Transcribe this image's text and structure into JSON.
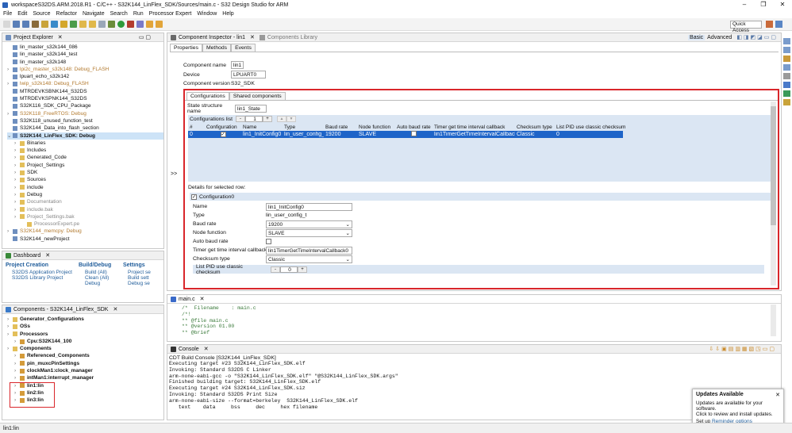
{
  "window": {
    "title": "workspaceS32DS.ARM.2018.R1 - C/C++ - S32K144_LinFlex_SDK/Sources/main.c - S32 Design Studio for ARM",
    "min": "–",
    "max": "❐",
    "close": "✕"
  },
  "menu": [
    "File",
    "Edit",
    "Source",
    "Refactor",
    "Navigate",
    "Search",
    "Run",
    "Processor Expert",
    "Window",
    "Help"
  ],
  "quick_access": "Quick Access",
  "project_explorer": {
    "title": "Project Explorer",
    "items": [
      {
        "label": "lin_master_s32k144_086",
        "cls": ""
      },
      {
        "label": "lin_master_s32k144_test",
        "cls": ""
      },
      {
        "label": "lin_master_s32k148",
        "cls": ""
      },
      {
        "label": "lpi2c_master_s32k148: Debug_FLASH",
        "cls": "orange",
        "tw": "›"
      },
      {
        "label": "lpuart_echo_s32k142",
        "cls": ""
      },
      {
        "label": "lwip_s32k148: Debug_FLASH",
        "cls": "orange",
        "tw": "›"
      },
      {
        "label": "MTRDEVKSBNK144_S32DS",
        "cls": ""
      },
      {
        "label": "MTRDEVKSPNK144_S32DS",
        "cls": ""
      },
      {
        "label": "S32K116_SDK_CPU_Package",
        "cls": ""
      },
      {
        "label": "S32K118_FreeRTOS: Debug",
        "cls": "orange",
        "tw": "›"
      },
      {
        "label": "S32K118_unused_function_test",
        "cls": ""
      },
      {
        "label": "S32K144_Data_into_flash_section",
        "cls": ""
      },
      {
        "label": "S32K144_LinFlex_SDK: Debug",
        "cls": "bold sel",
        "tw": "⌄"
      },
      {
        "label": "Binaries",
        "cls": "",
        "ind": 1,
        "tw": "›"
      },
      {
        "label": "Includes",
        "cls": "",
        "ind": 1,
        "tw": "›"
      },
      {
        "label": "Generated_Code",
        "cls": "",
        "ind": 1,
        "tw": "›"
      },
      {
        "label": "Project_Settings",
        "cls": "",
        "ind": 1,
        "tw": "›"
      },
      {
        "label": "SDK",
        "cls": "",
        "ind": 1,
        "tw": "›"
      },
      {
        "label": "Sources",
        "cls": "",
        "ind": 1,
        "tw": "›"
      },
      {
        "label": "include",
        "cls": "",
        "ind": 1,
        "tw": "›"
      },
      {
        "label": "Debug",
        "cls": "",
        "ind": 1,
        "tw": "›"
      },
      {
        "label": "Documentation",
        "cls": "gray",
        "ind": 1,
        "tw": "›"
      },
      {
        "label": "include.bak",
        "cls": "gray",
        "ind": 1,
        "tw": "›"
      },
      {
        "label": "Project_Settings.bak",
        "cls": "gray",
        "ind": 1,
        "tw": "›"
      },
      {
        "label": "ProcessorExpert.pe",
        "cls": "gray",
        "ind": 2
      },
      {
        "label": "S32K144_memcpy: Debug",
        "cls": "orange",
        "tw": "›"
      },
      {
        "label": "S32K144_newProject",
        "cls": ""
      }
    ]
  },
  "dashboard": {
    "title": "Dashboard",
    "project_creation": {
      "title": "Project Creation",
      "links": [
        "S32DS Application Project",
        "S32DS Library Project"
      ]
    },
    "build_debug": {
      "title": "Build/Debug",
      "links": [
        "Build  (All)",
        "Clean  (All)",
        "Debug"
      ]
    },
    "settings": {
      "title": "Settings",
      "links": [
        "Project se",
        "Build sett",
        "Debug se"
      ]
    }
  },
  "components": {
    "title": "Components - S32K144_LinFlex_SDK",
    "items": [
      {
        "label": "Generator_Configurations",
        "bold": true,
        "ind": 0
      },
      {
        "label": "OSs",
        "bold": true,
        "ind": 0
      },
      {
        "label": "Processors",
        "bold": true,
        "ind": 0
      },
      {
        "label": "Cpu:S32K144_100",
        "bold": true,
        "ind": 1
      },
      {
        "label": "Components",
        "bold": true,
        "ind": 0
      },
      {
        "label": "Referenced_Components",
        "bold": true,
        "ind": 1
      },
      {
        "label": "pin_muxcPinSettings",
        "bold": true,
        "ind": 1
      },
      {
        "label": "clockMan1:clock_manager",
        "bold": true,
        "ind": 1
      },
      {
        "label": "intMan1:interrupt_manager",
        "bold": true,
        "ind": 1
      },
      {
        "label": "lin1:lin",
        "bold": true,
        "ind": 1
      },
      {
        "label": "lin2:lin",
        "bold": true,
        "ind": 1
      },
      {
        "label": "lin3:lin",
        "bold": true,
        "ind": 1
      }
    ]
  },
  "inspector": {
    "title": "Component Inspector - lin1",
    "library_tab": "Components Library",
    "basic": "Basic",
    "advanced": "Advanced",
    "tabs": [
      "Properties",
      "Methods",
      "Events"
    ],
    "component_name_label": "Component name",
    "component_name": "lin1",
    "device_label": "Device",
    "device": "LPUART0",
    "version_label": "Component version",
    "version": "S32_SDK",
    "subtabs": [
      "Configurations",
      "Shared components"
    ],
    "state_label": "State structure name",
    "state_value": "lin1_State",
    "configs_list_label": "Configurations list",
    "configs_count": "1",
    "columns": [
      "#",
      "Configuration",
      "Name",
      "Type",
      "Baud rate",
      "Node function",
      "Auto baud rate",
      "Timer get time interval callback",
      "Checksum type",
      "List PID use classic checksum"
    ],
    "row": {
      "num": "0",
      "name": "lin1_InitConfig0",
      "type": "lin_user_config_t",
      "baud": "19200",
      "node": "SLAVE",
      "timer": "lin1TimerGetTimeIntervalCallback0",
      "checksum": "Classic",
      "pid": "0"
    },
    "details_label": "Details for selected row:",
    "detail_group": "Configuration0",
    "details": {
      "name_l": "Name",
      "name_v": "lin1_InitConfig0",
      "type_l": "Type",
      "type_v": "lin_user_config_t",
      "baud_l": "Baud rate",
      "baud_v": "19200",
      "node_l": "Node function",
      "node_v": "SLAVE",
      "auto_l": "Auto baud rate",
      "timer_l": "Timer get time interval callback",
      "timer_v": "lin1TimerGetTimeIntervalCallback0",
      "cks_l": "Checksum type",
      "cks_v": "Classic",
      "pid_l": "List PID use classic checksum",
      "pid_v": "0"
    }
  },
  "editor": {
    "tab": "main.c",
    "lines": [
      {
        "t": "/*  Filename    : main.c",
        "c": "cmt"
      },
      {
        "t": "/*!",
        "c": "cmt"
      },
      {
        "t": "** @file main.c",
        "c": "cmt"
      },
      {
        "t": "** @version 01.00",
        "c": "cmt"
      },
      {
        "t": "** @brief",
        "c": "cmt"
      }
    ]
  },
  "console": {
    "tab": "Console",
    "title": "CDT Build Console [S32K144_LinFlex_SDK]",
    "lines": [
      "Executing target #23 S32K144_LinFlex_SDK.elf",
      "Invoking: Standard S32DS C Linker",
      "arm-none-eabi-gcc -o \"S32K144_LinFlex_SDK.elf\" \"@S32K144_LinFlex_SDK.args\"",
      "Finished building target: S32K144_LinFlex_SDK.elf",
      "",
      "Executing target #24 S32K144_LinFlex_SDK.siz",
      "Invoking: Standard S32DS Print Size",
      "arm-none-eabi-size --format=berkeley  S32K144_LinFlex_SDK.elf",
      "   text    data     bss     dec     hex filename"
    ]
  },
  "updates": {
    "title": "Updates Available",
    "body1": "Updates are available for your software.",
    "body2": "Click to review and install updates.",
    "setup": "Set up",
    "reminder": "Reminder options"
  },
  "status": {
    "text": "lin1:lin"
  }
}
